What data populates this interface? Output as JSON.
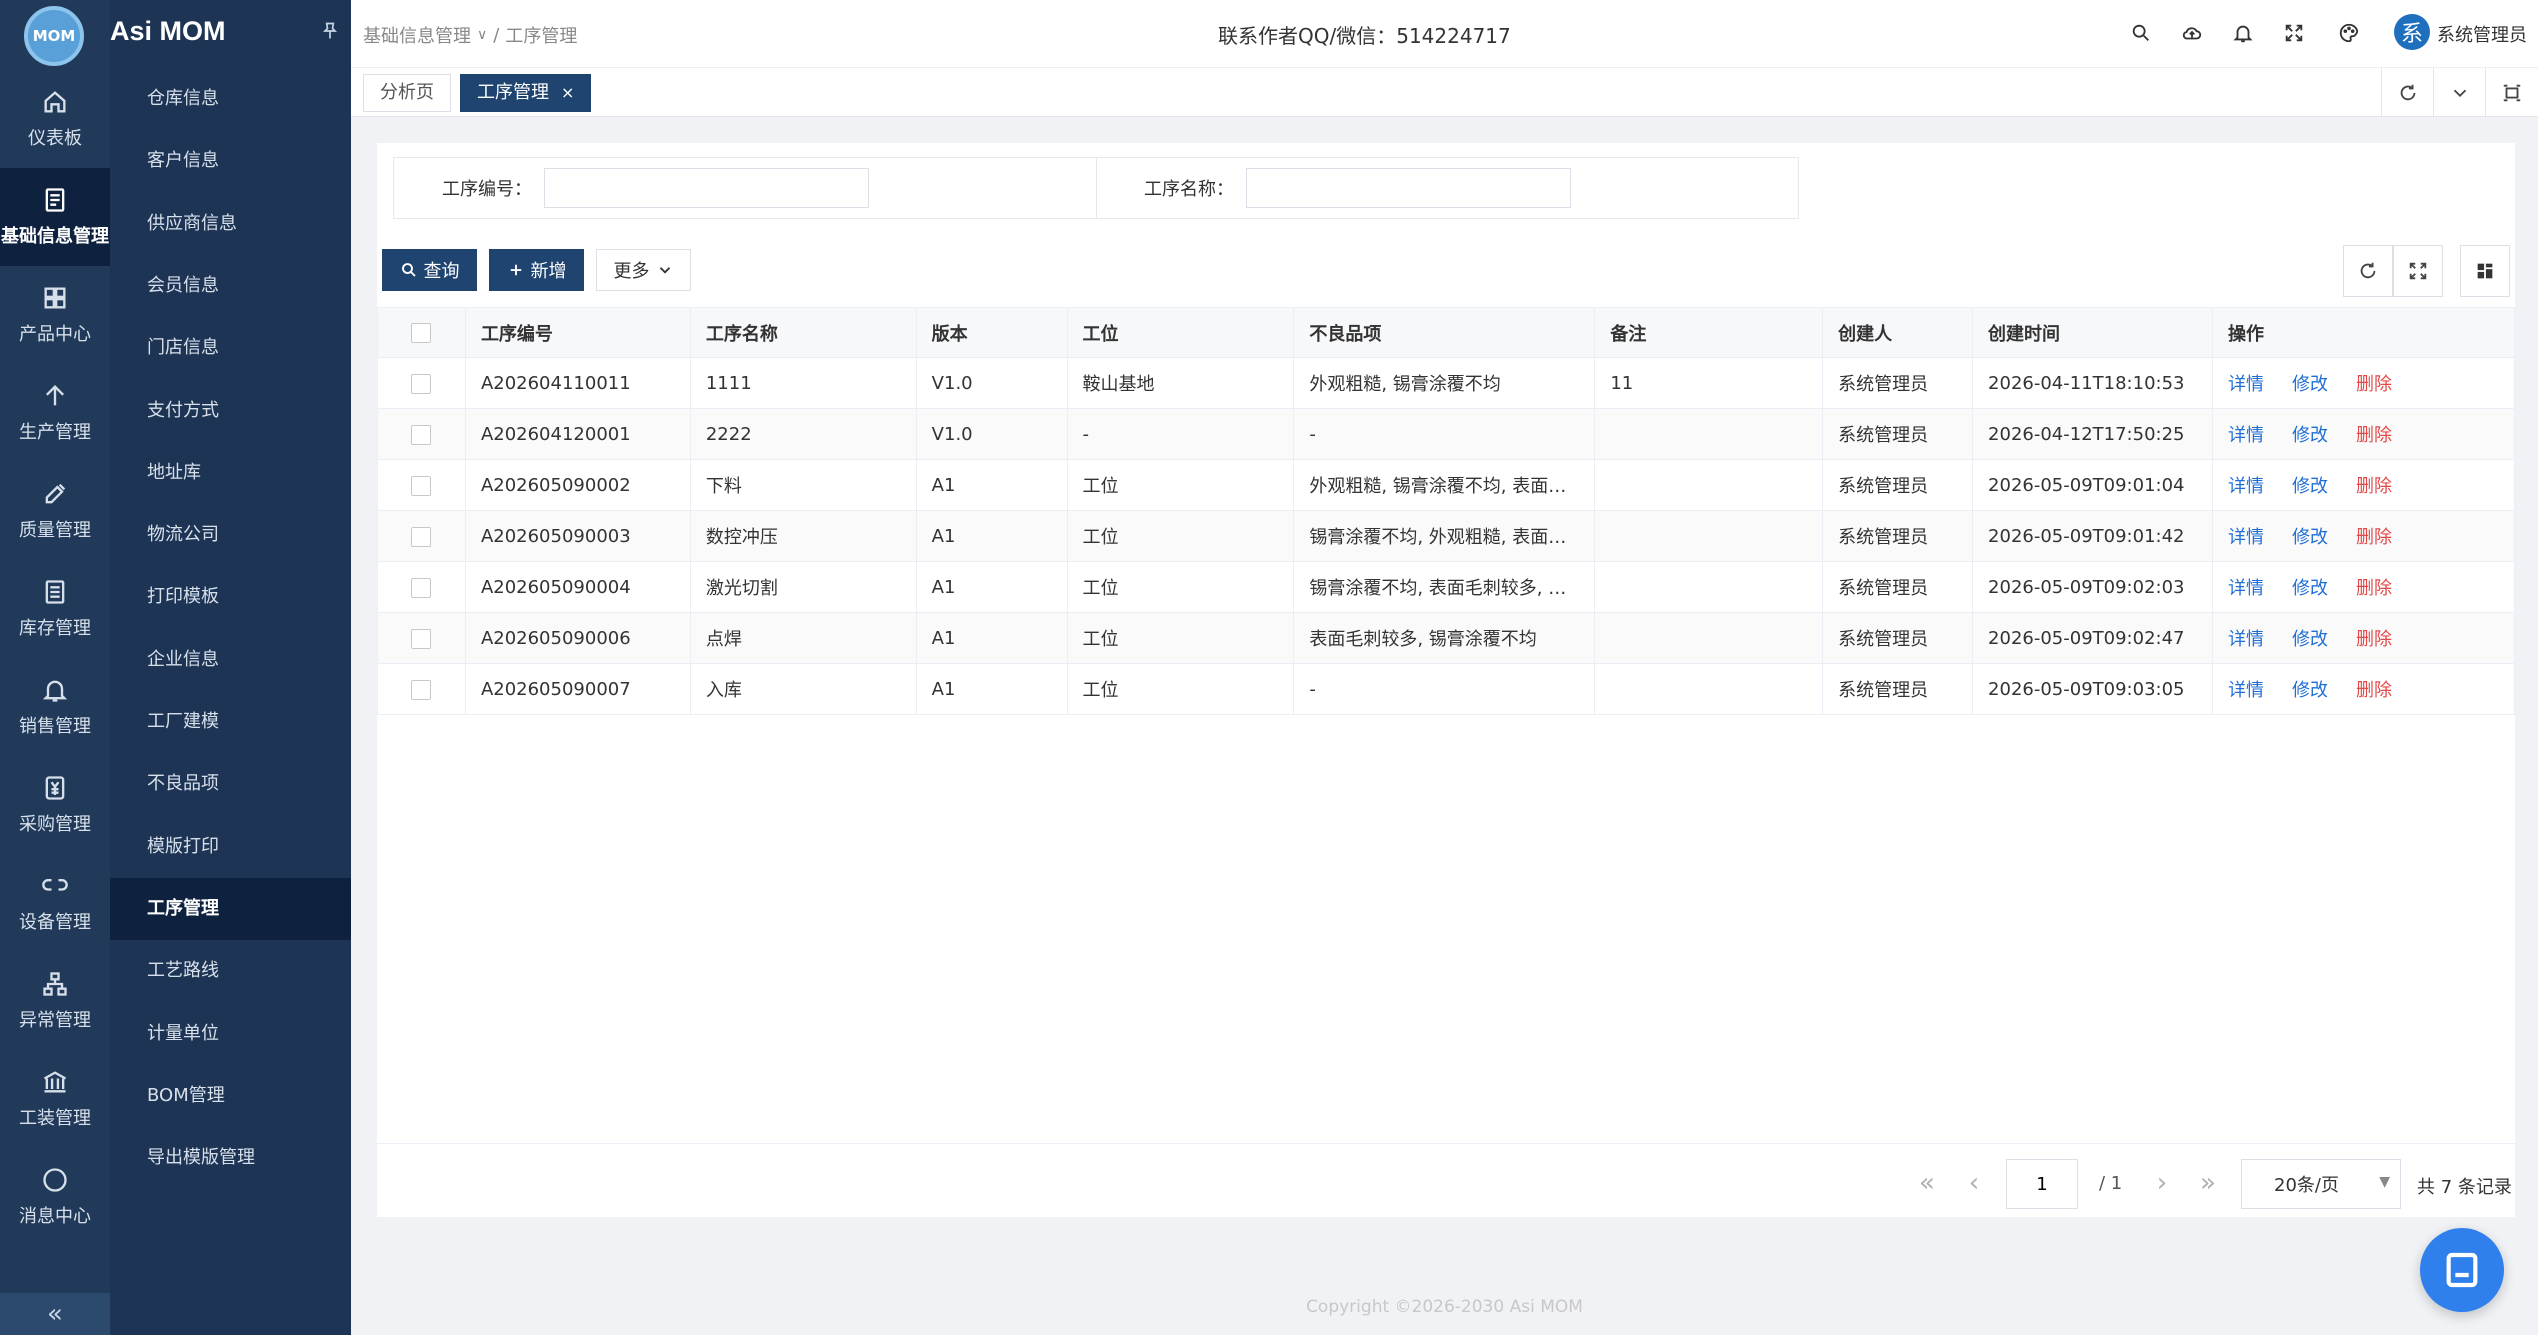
{
  "app": {
    "logo_text": "MOM",
    "title": "Asi MOM"
  },
  "rail": [
    {
      "label": "仪表板",
      "icon": "home-icon"
    },
    {
      "label": "基础信息管理",
      "icon": "document-icon",
      "active": true
    },
    {
      "label": "产品中心",
      "icon": "grid-icon"
    },
    {
      "label": "生产管理",
      "icon": "arrow-up-icon"
    },
    {
      "label": "质量管理",
      "icon": "tool-icon"
    },
    {
      "label": "库存管理",
      "icon": "list-icon"
    },
    {
      "label": "销售管理",
      "icon": "bell-icon"
    },
    {
      "label": "采购管理",
      "icon": "yen-icon"
    },
    {
      "label": "设备管理",
      "icon": "link-icon"
    },
    {
      "label": "异常管理",
      "icon": "hierarchy-icon"
    },
    {
      "label": "工装管理",
      "icon": "bank-icon"
    },
    {
      "label": "消息中心",
      "icon": "chat-icon"
    }
  ],
  "rail_collapse": "«",
  "submenu": [
    {
      "label": "仓库信息"
    },
    {
      "label": "客户信息"
    },
    {
      "label": "供应商信息"
    },
    {
      "label": "会员信息"
    },
    {
      "label": "门店信息"
    },
    {
      "label": "支付方式"
    },
    {
      "label": "地址库"
    },
    {
      "label": "物流公司"
    },
    {
      "label": "打印模板"
    },
    {
      "label": "企业信息"
    },
    {
      "label": "工厂建模"
    },
    {
      "label": "不良品项"
    },
    {
      "label": "模版打印"
    },
    {
      "label": "工序管理",
      "active": true
    },
    {
      "label": "工艺路线"
    },
    {
      "label": "计量单位"
    },
    {
      "label": "BOM管理"
    },
    {
      "label": "导出模版管理"
    }
  ],
  "header": {
    "breadcrumb_root": "基础信息管理",
    "breadcrumb_sep": "/",
    "breadcrumb_current": "工序管理",
    "contact": "联系作者QQ/微信：514224717",
    "avatar_char": "系",
    "username": "系统管理员"
  },
  "tabs": [
    {
      "label": "分析页"
    },
    {
      "label": "工序管理",
      "active": true,
      "close": "×"
    }
  ],
  "search": {
    "code_label": "工序编号：",
    "code_value": "",
    "name_label": "工序名称：",
    "name_value": ""
  },
  "toolbar": {
    "query": "查询",
    "add": "新增",
    "more": "更多"
  },
  "table": {
    "columns": [
      "工序编号",
      "工序名称",
      "版本",
      "工位",
      "不良品项",
      "备注",
      "创建人",
      "创建时间",
      "操作"
    ],
    "rows": [
      [
        "A202604110011",
        "1111",
        "V1.0",
        "鞍山基地",
        "外观粗糙, 锡膏涂覆不均",
        "11",
        "系统管理员",
        "2026-04-11T18:10:53"
      ],
      [
        "A202604120001",
        "2222",
        "V1.0",
        "-",
        "-",
        "",
        "系统管理员",
        "2026-04-12T17:50:25"
      ],
      [
        "A202605090002",
        "下料",
        "A1",
        "工位",
        "外观粗糙, 锡膏涂覆不均, 表面毛...",
        "",
        "系统管理员",
        "2026-05-09T09:01:04"
      ],
      [
        "A202605090003",
        "数控冲压",
        "A1",
        "工位",
        "锡膏涂覆不均, 外观粗糙, 表面毛...",
        "",
        "系统管理员",
        "2026-05-09T09:01:42"
      ],
      [
        "A202605090004",
        "激光切割",
        "A1",
        "工位",
        "锡膏涂覆不均, 表面毛刺较多, 外...",
        "",
        "系统管理员",
        "2026-05-09T09:02:03"
      ],
      [
        "A202605090006",
        "点焊",
        "A1",
        "工位",
        "表面毛刺较多, 锡膏涂覆不均",
        "",
        "系统管理员",
        "2026-05-09T09:02:47"
      ],
      [
        "A202605090007",
        "入库",
        "A1",
        "工位",
        "-",
        "",
        "系统管理员",
        "2026-05-09T09:03:05"
      ]
    ],
    "actions": [
      "详情",
      "修改",
      "删除"
    ]
  },
  "pager": {
    "page": "1",
    "total_pages": "/ 1",
    "page_size": "20条/页",
    "total": "共 7 条记录"
  },
  "footer": "Copyright ©2026-2030 Asi MOM"
}
